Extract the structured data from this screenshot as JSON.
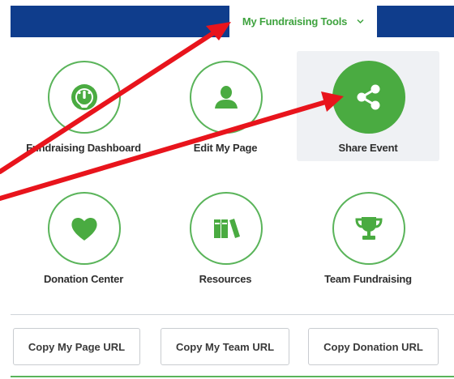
{
  "nav": {
    "tools_label": "My Fundraising Tools"
  },
  "tiles": [
    {
      "label": "Fundraising Dashboard",
      "icon": "dashboard-gauge-icon"
    },
    {
      "label": "Edit My Page",
      "icon": "user-icon"
    },
    {
      "label": "Share Event",
      "icon": "share-icon"
    },
    {
      "label": "Donation Center",
      "icon": "heart-icon"
    },
    {
      "label": "Resources",
      "icon": "books-icon"
    },
    {
      "label": "Team Fundraising",
      "icon": "trophy-icon"
    }
  ],
  "buttons": {
    "copy_page_url": "Copy My Page URL",
    "copy_team_url": "Copy My Team URL",
    "copy_donation_url": "Copy Donation URL"
  },
  "colors": {
    "navy": "#0f3d8c",
    "green": "#4aab41",
    "annotation_red": "#e8141c"
  }
}
